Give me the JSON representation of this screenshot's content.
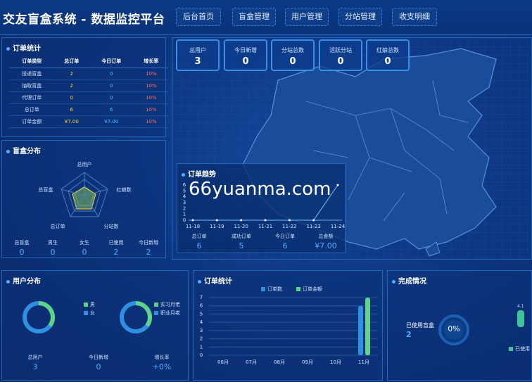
{
  "header": {
    "title": "交友盲盒系统 - 数据监控平台",
    "nav": [
      "后台首页",
      "盲盒管理",
      "用户管理",
      "分站管理",
      "收支明细"
    ]
  },
  "order_panel": {
    "title": "订单统计",
    "columns": [
      "订单类型",
      "总订单",
      "今日订单",
      "增长率"
    ],
    "rows": [
      [
        "投递盲盒",
        "2",
        "0",
        "10%"
      ],
      [
        "抽取盲盒",
        "2",
        "0",
        "10%"
      ],
      [
        "代理订单",
        "0",
        "0",
        "10%"
      ],
      [
        "总订单",
        "6",
        "6",
        "10%"
      ],
      [
        "订单金额",
        "¥7.00",
        "¥7.00",
        "10%"
      ]
    ]
  },
  "top_stats": [
    {
      "label": "总用户",
      "value": "3"
    },
    {
      "label": "今日新增",
      "value": "0"
    },
    {
      "label": "分站总数",
      "value": "0"
    },
    {
      "label": "活跃分站",
      "value": "0"
    },
    {
      "label": "红娘总数",
      "value": "0"
    }
  ],
  "box_panel": {
    "title": "盲盒分布",
    "radar_labels": [
      "总用户",
      "红娘数",
      "分站数",
      "总订单",
      "总盲盒"
    ],
    "stats": [
      {
        "label": "总盲盒",
        "value": "0"
      },
      {
        "label": "男生",
        "value": "0"
      },
      {
        "label": "女生",
        "value": "0"
      },
      {
        "label": "已使用",
        "value": "2"
      },
      {
        "label": "今日新增",
        "value": "2"
      }
    ]
  },
  "trend_panel": {
    "title": "订单趋势",
    "stats": [
      {
        "label": "总订单",
        "value": "6"
      },
      {
        "label": "成功订单",
        "value": "5"
      },
      {
        "label": "今日订单",
        "value": "6"
      },
      {
        "label": "总金额",
        "value": "¥7.00"
      }
    ]
  },
  "user_panel": {
    "title": "用户分布",
    "legend1": [
      "男",
      "女"
    ],
    "legend2": [
      "实习月老",
      "职业月老"
    ],
    "stats": [
      {
        "label": "总用户",
        "value": "3"
      },
      {
        "label": "今日新增",
        "value": "0"
      },
      {
        "label": "增长率",
        "value": "+0%"
      }
    ]
  },
  "order_chart_panel": {
    "title": "订单统计",
    "legend": [
      "订单数",
      "订单金额"
    ]
  },
  "complete_panel": {
    "title": "完成情况",
    "used_label": "已使用盲盒",
    "used_value": "2",
    "percent": "0%",
    "small_value": "4.1",
    "legend": "已使用"
  },
  "watermark": "66yuanma.com",
  "colors": {
    "accent": "#4fb0ff",
    "green": "#5ed48a",
    "blue": "#2f8fe0",
    "yellow": "#ffd633",
    "red": "#ff6a5a"
  },
  "chart_data": [
    {
      "type": "line",
      "x": [
        "11-18",
        "11-19",
        "11-20",
        "11-21",
        "11-22",
        "11-23",
        "11-24"
      ],
      "series": [
        {
          "values": [
            0,
            0,
            0,
            0,
            0,
            0,
            6
          ]
        }
      ],
      "yticks": [
        0,
        1,
        2,
        3,
        4,
        5,
        6
      ],
      "ylim": [
        0,
        6
      ]
    },
    {
      "type": "bar",
      "categories": [
        "06月",
        "07月",
        "08月",
        "09月",
        "10月",
        "11月"
      ],
      "series": [
        {
          "name": "订单数",
          "values": [
            0,
            0,
            0,
            0,
            0,
            6
          ]
        },
        {
          "name": "订单金额",
          "values": [
            0,
            0,
            0,
            0,
            0,
            7
          ]
        }
      ],
      "yticks": [
        0,
        1,
        2,
        3,
        4,
        5,
        6,
        7
      ],
      "ylim": [
        0,
        7
      ]
    }
  ]
}
